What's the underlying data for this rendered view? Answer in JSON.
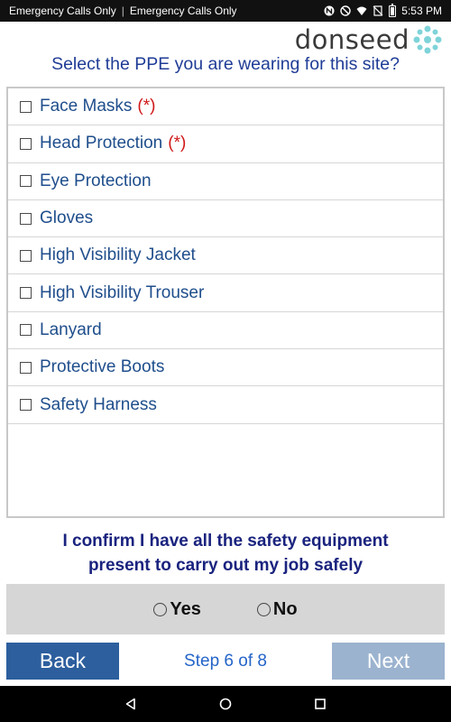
{
  "status_bar": {
    "left_text_1": "Emergency Calls Only",
    "separator": "|",
    "left_text_2": "Emergency Calls Only",
    "time": "5:53 PM",
    "icons": [
      "nfc-icon",
      "do-not-disturb-icon",
      "wifi-icon",
      "no-sim-icon",
      "battery-icon"
    ]
  },
  "header": {
    "logo_text": "donseed",
    "logo_accent_color": "#7ed3d9"
  },
  "question": "Select the PPE you are wearing for this site?",
  "ppe_items": [
    {
      "label": "Face Masks",
      "required": "(*)"
    },
    {
      "label": "Head Protection",
      "required": "(*)"
    },
    {
      "label": "Eye Protection",
      "required": ""
    },
    {
      "label": "Gloves",
      "required": ""
    },
    {
      "label": "High Visibility Jacket",
      "required": ""
    },
    {
      "label": "High Visibility Trouser",
      "required": ""
    },
    {
      "label": "Lanyard",
      "required": ""
    },
    {
      "label": "Protective Boots",
      "required": ""
    },
    {
      "label": "Safety Harness",
      "required": ""
    }
  ],
  "confirmation": {
    "line1": "I confirm I have all the safety equipment",
    "line2": "present to carry out my job safely",
    "yes_label": "Yes",
    "no_label": "No"
  },
  "footer": {
    "back_label": "Back",
    "step_label": "Step 6 of 8",
    "next_label": "Next"
  },
  "colors": {
    "primary": "#2d5f9e",
    "disabled": "#9bb3cf",
    "required": "#d01818",
    "question_text": "#1f3c96"
  },
  "nav_bar": {
    "icons": [
      "back-nav-icon",
      "home-nav-icon",
      "recents-nav-icon"
    ]
  }
}
